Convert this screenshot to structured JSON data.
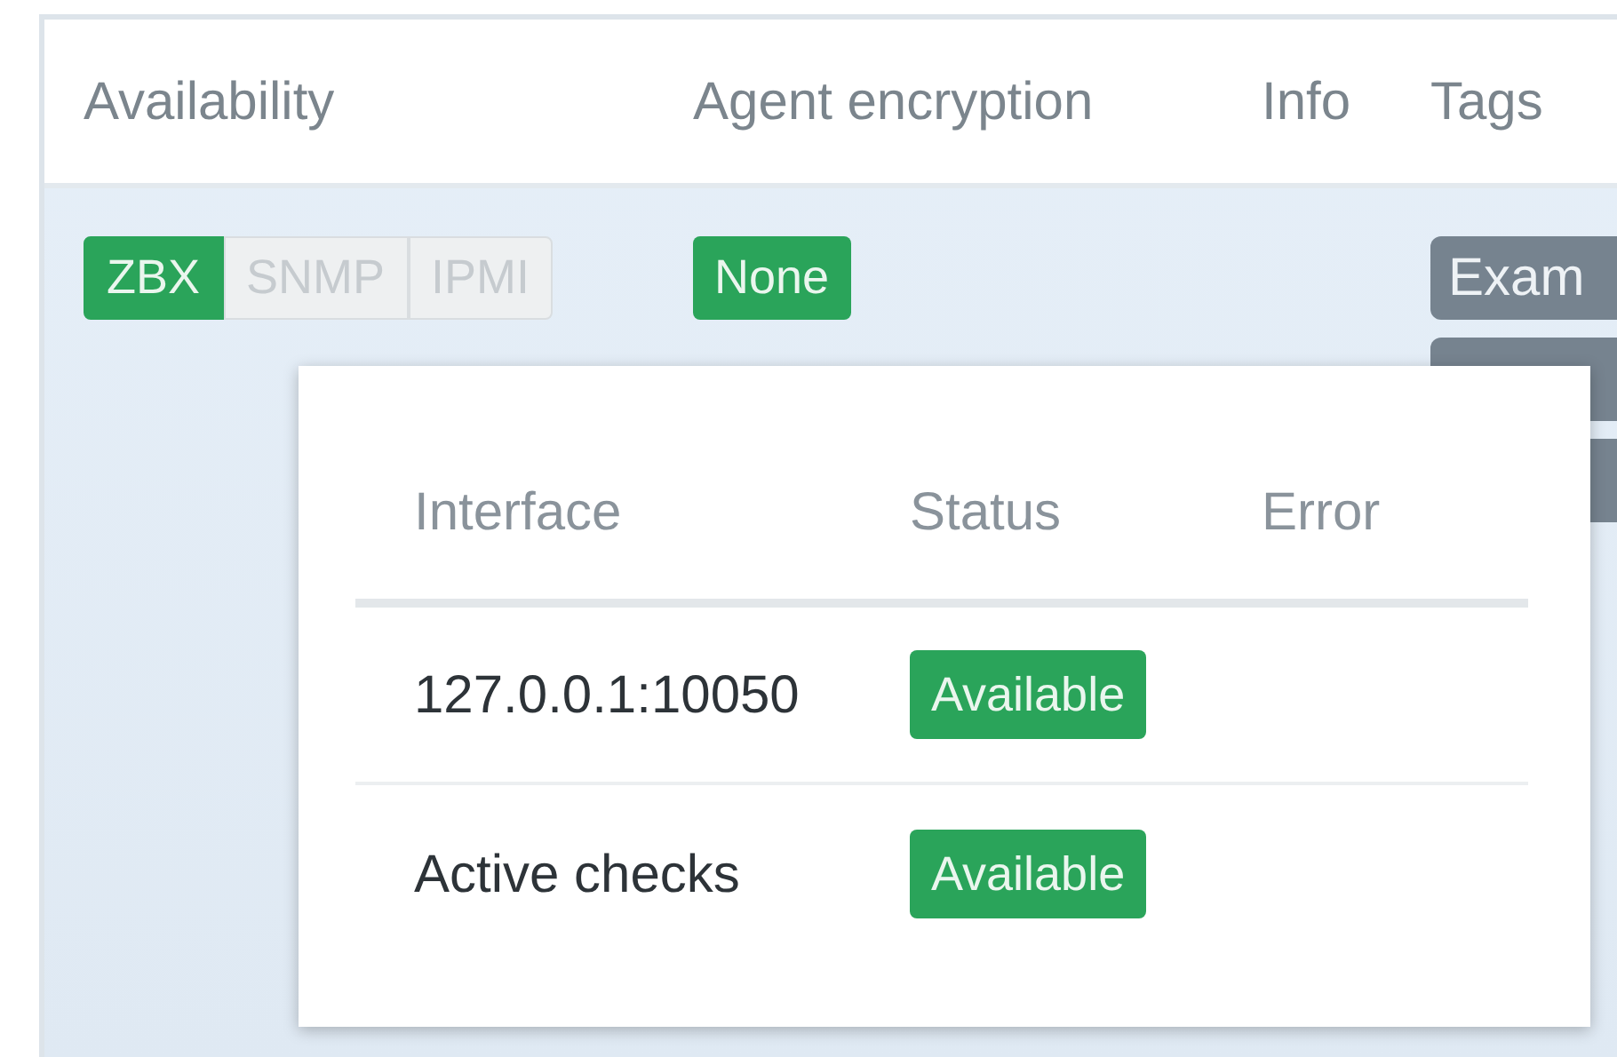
{
  "table": {
    "columns": [
      "Availability",
      "Agent encryption",
      "Info",
      "Tags"
    ],
    "row": {
      "availability": [
        {
          "label": "ZBX",
          "kind": "available"
        },
        {
          "label": "SNMP",
          "kind": "unknown"
        },
        {
          "label": "IPMI",
          "kind": "unknown"
        }
      ],
      "encryption": {
        "label": "None",
        "kind": "available"
      },
      "tags": [
        {
          "label": "Exam",
          "kind": "visible"
        },
        {
          "kind": "covered"
        },
        {
          "kind": "covered"
        }
      ]
    }
  },
  "popup": {
    "columns": [
      "Interface",
      "Status",
      "Error"
    ],
    "rows": [
      {
        "interface": "127.0.0.1:10050",
        "status": "Available",
        "kind": "available"
      },
      {
        "interface": "Active checks",
        "status": "Available",
        "kind": "available"
      }
    ]
  }
}
